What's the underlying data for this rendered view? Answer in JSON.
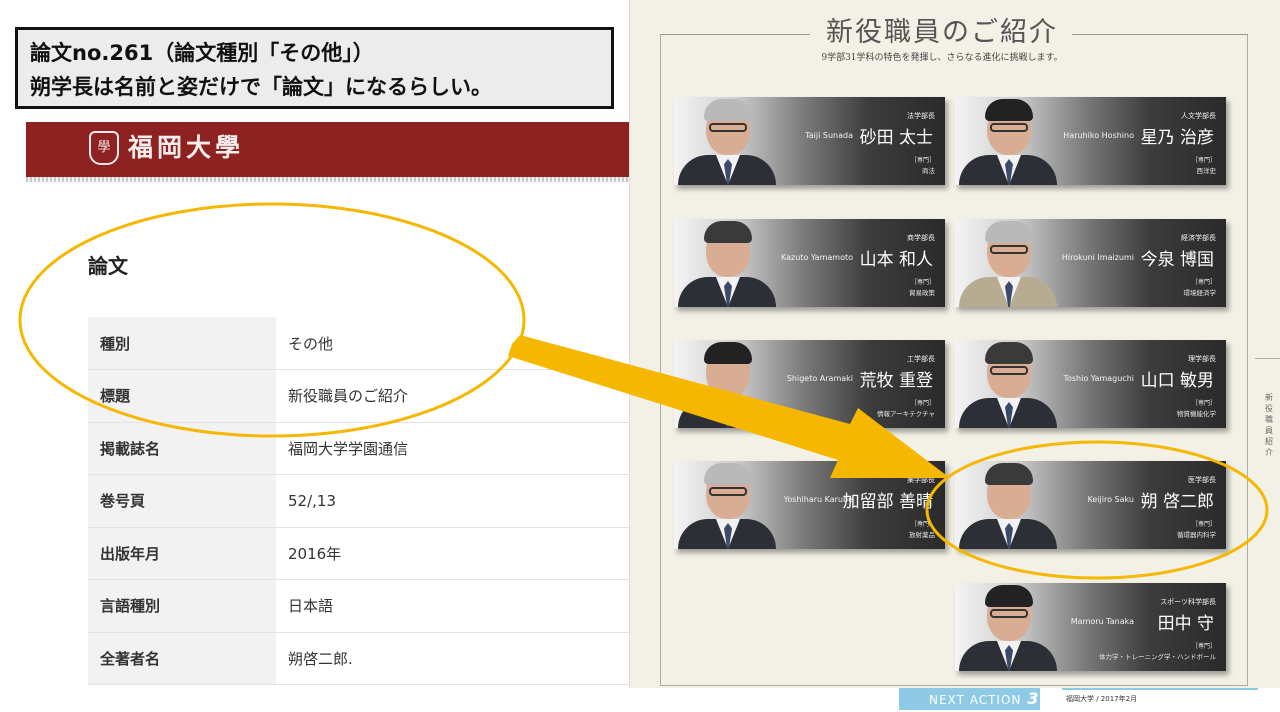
{
  "caption": {
    "line1": "論文no.261（論文種別「その他」）",
    "line2": "朔学長は名前と姿だけで「論文」になるらしい。"
  },
  "university": {
    "logo_mark": "學",
    "logo_text": "福岡大學",
    "header_color": "#8e2221"
  },
  "paper": {
    "section_title": "論文",
    "rows": [
      {
        "label": "種別",
        "value": "その他"
      },
      {
        "label": "標題",
        "value": "新役職員のご紹介"
      },
      {
        "label": "掲載誌名",
        "value": "福岡大学学園通信"
      },
      {
        "label": "巻号頁",
        "value": "52/,13"
      },
      {
        "label": "出版年月",
        "value": "2016年"
      },
      {
        "label": "言語種別",
        "value": "日本語"
      },
      {
        "label": "全著者名",
        "value": "朔啓二郎."
      }
    ]
  },
  "magazine": {
    "title": "新役職員のご紹介",
    "subtitle": "9学部31学科の特色を発揮し、さらなる進化に挑戦します。",
    "spec_label": "［専門］",
    "cards": [
      {
        "dept": "法学部長",
        "romaji": "Taiji Sunada",
        "name": "砂田 太士",
        "spec": "商法"
      },
      {
        "dept": "人文学部長",
        "romaji": "Haruhiko Hoshino",
        "name": "星乃 治彦",
        "spec": "西洋史"
      },
      {
        "dept": "商学部長",
        "romaji": "Kazuto Yamamoto",
        "name": "山本 和人",
        "spec": "貿易政策"
      },
      {
        "dept": "経済学部長",
        "romaji": "Hirokuni Imaizumi",
        "name": "今泉 博国",
        "spec": "環境経済学"
      },
      {
        "dept": "工学部長",
        "romaji": "Shigeto Aramaki",
        "name": "荒牧 重登",
        "spec": "情報アーキテクチャ"
      },
      {
        "dept": "理学部長",
        "romaji": "Toshio Yamaguchi",
        "name": "山口 敏男",
        "spec": "物質機能化学"
      },
      {
        "dept": "薬学部長",
        "romaji": "Yoshiharu Karube",
        "name": "加留部 善晴",
        "spec": "放射薬品"
      },
      {
        "dept": "医学部長",
        "romaji": "Keijiro Saku",
        "name": "朔 啓二郎",
        "spec": "循環器内科学"
      },
      {
        "dept": "スポーツ科学部長",
        "romaji": "Mamoru Tanaka",
        "name": "田中 守",
        "spec": "体力学・トレーニング学・ハンドボール"
      }
    ],
    "side_text": "新役職員紹介",
    "next_action_label": "NEXT ACTION",
    "next_action_number": "3",
    "footer_note": "福岡大学 / 2017年2月"
  },
  "colors": {
    "highlight": "#f5b700",
    "accent_blue": "#8ec9e6"
  }
}
